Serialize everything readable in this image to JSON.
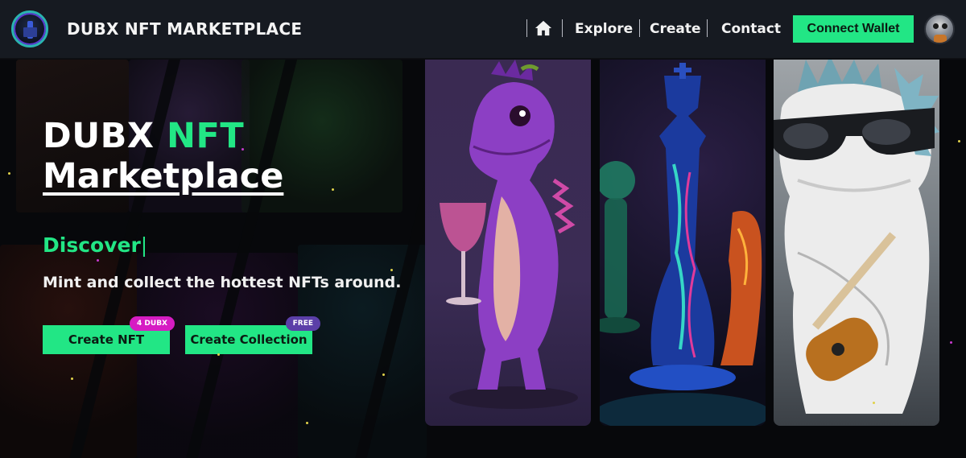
{
  "header": {
    "brand": "DUBX NFT MARKETPLACE",
    "logo_icon": "tower-logo-icon",
    "home_icon": "home-icon",
    "nav": [
      "Explore",
      "Create",
      "Contact"
    ],
    "connect_label": "Connect Wallet",
    "avatar_icon": "robot-avatar-icon"
  },
  "hero": {
    "title_white": "DUBX",
    "title_accent": "NFT",
    "title_line2": "Marketplace",
    "typed_text": "Discover",
    "typed_cursor": "|",
    "tagline": "Mint and collect the hottest NFTs around.",
    "buttons": [
      {
        "label": "Create NFT",
        "badge": "4 DUBX"
      },
      {
        "label": "Create Collection",
        "badge": "FREE"
      }
    ]
  },
  "cards": [
    {
      "subject": "purple-dinosaur-with-wine-glass"
    },
    {
      "subject": "glowing-chess-pieces"
    },
    {
      "subject": "white-dragon-with-sunglasses-and-guitar"
    }
  ],
  "colors": {
    "accent": "#22e685",
    "nav_bg": "#161a21",
    "page_bg": "#07080b",
    "badge_dubx": "#d61cc3",
    "badge_free": "#5b3fa8"
  }
}
